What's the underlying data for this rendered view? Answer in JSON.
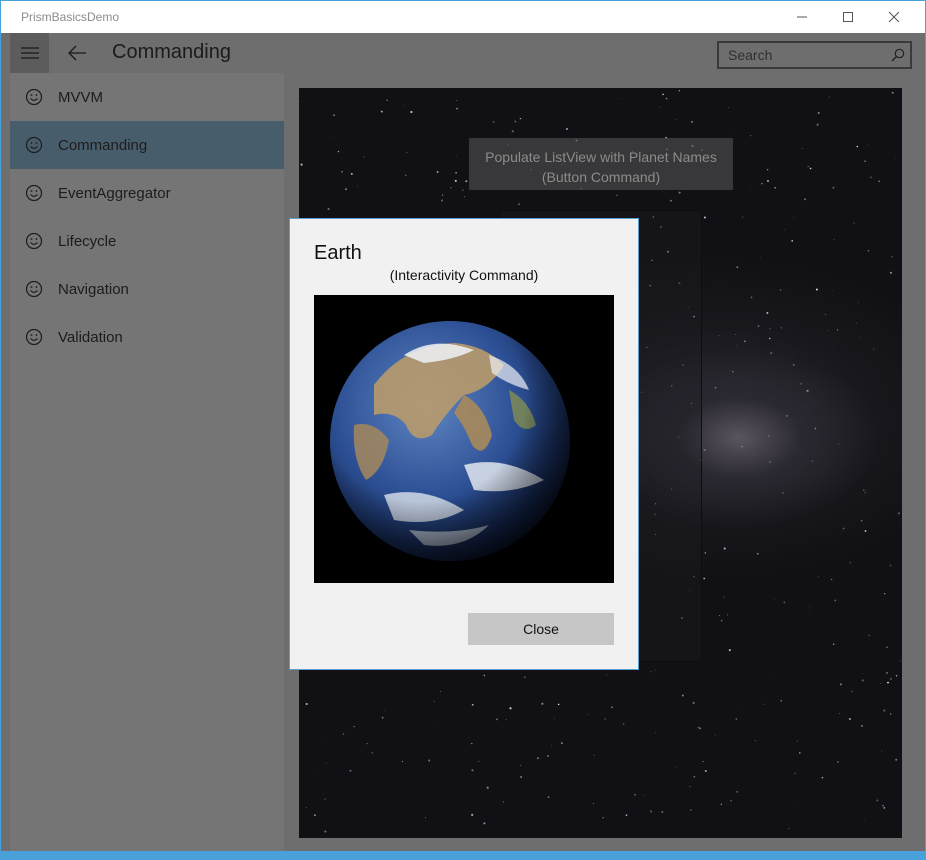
{
  "window": {
    "title": "PrismBasicsDemo"
  },
  "header": {
    "page_title": "Commanding",
    "search_placeholder": "Search"
  },
  "nav": {
    "items": [
      {
        "label": "MVVM",
        "icon": "smiley-icon"
      },
      {
        "label": "Commanding",
        "icon": "smiley-icon",
        "selected": true
      },
      {
        "label": "EventAggregator",
        "icon": "smiley-icon"
      },
      {
        "label": "Lifecycle",
        "icon": "smiley-icon"
      },
      {
        "label": "Navigation",
        "icon": "smiley-icon"
      },
      {
        "label": "Validation",
        "icon": "smiley-icon"
      }
    ]
  },
  "content": {
    "populate_button_line1": "Populate ListView with Planet Names",
    "populate_button_line2": "(Button Command)"
  },
  "dialog": {
    "title": "Earth",
    "subtitle": "(Interactivity Command)",
    "image": "earth-image",
    "close_label": "Close"
  },
  "colors": {
    "accent_border": "#4aa0d8",
    "selected_nav": "#485d6b",
    "dialog_bg": "#f1f1f1"
  }
}
